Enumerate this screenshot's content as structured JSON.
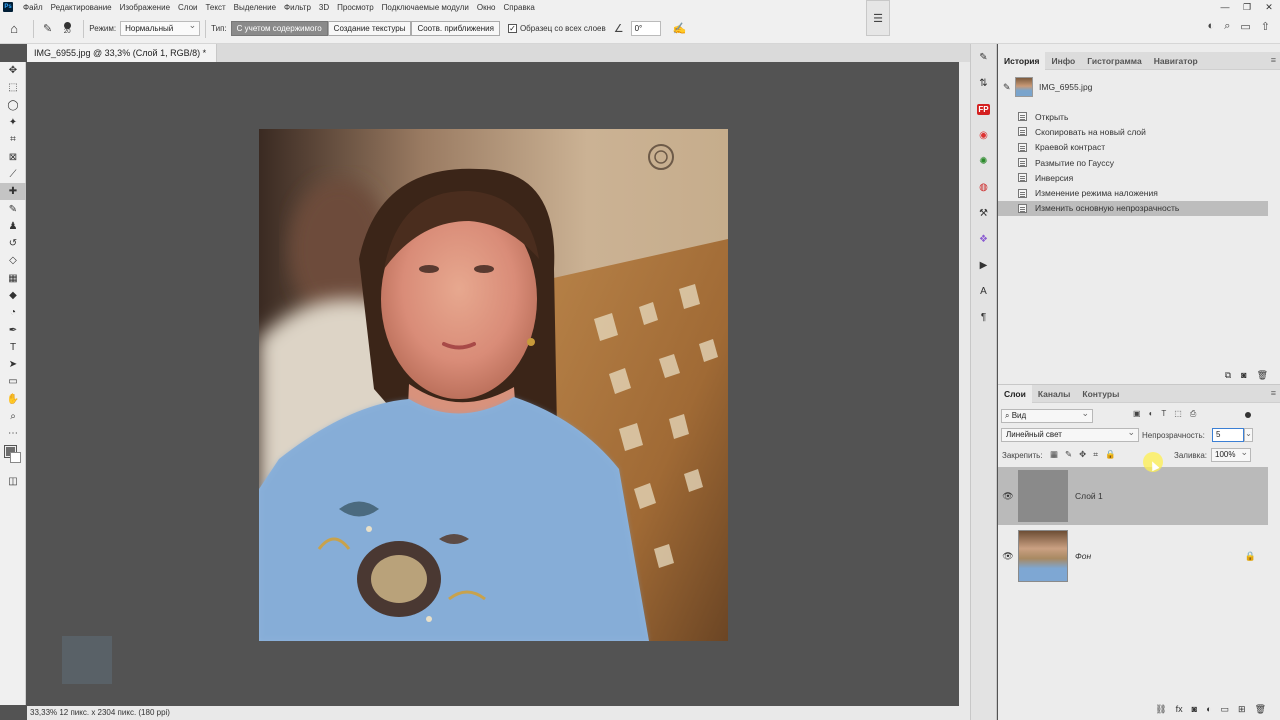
{
  "menubar": {
    "logo": "Ps",
    "items": [
      "Файл",
      "Редактирование",
      "Изображение",
      "Слои",
      "Текст",
      "Выделение",
      "Фильтр",
      "3D",
      "Просмотр",
      "Подключаемые модули",
      "Окно",
      "Справка"
    ],
    "window_controls": [
      "—",
      "❐",
      "✕"
    ]
  },
  "options": {
    "brush_size": "20",
    "mode_label": "Режим:",
    "mode_value": "Нормальный",
    "type_label": "Тип:",
    "type_options": [
      "С учетом содержимого",
      "Создание текстуры",
      "Соотв. приближения"
    ],
    "type_selected": "С учетом содержимого",
    "sample_all_label": "Образец со всех слоев",
    "sample_all_checked": true,
    "angle_value": "0°"
  },
  "document": {
    "tab_title": "IMG_6955.jpg @ 33,3% (Слой 1, RGB/8) *",
    "status": "33,33%   12 пикс. x 2304 пикс. (180 ppi)"
  },
  "tools": [
    "move",
    "marquee",
    "lasso",
    "magic-wand",
    "crop",
    "frame",
    "eyedropper",
    "healing-brush",
    "brush",
    "clone-stamp",
    "history-brush",
    "eraser",
    "gradient",
    "blur",
    "dodge",
    "pen",
    "type",
    "path-select",
    "rectangle",
    "hand",
    "zoom",
    "more"
  ],
  "history": {
    "tabs": [
      "История",
      "Инфо",
      "Гистограмма",
      "Навигатор"
    ],
    "active_tab": "История",
    "snapshot_name": "IMG_6955.jpg",
    "steps": [
      "Открыть",
      "Скопировать на новый слой",
      "Краевой контраст",
      "Размытие по Гауссу",
      "Инверсия",
      "Изменение режима наложения",
      "Изменить основную непрозрачность"
    ],
    "selected_step": "Изменить основную непрозрачность"
  },
  "layers": {
    "tabs": [
      "Слои",
      "Каналы",
      "Контуры"
    ],
    "active_tab": "Слои",
    "filter_value": "Вид",
    "blend_mode": "Линейный свет",
    "opacity_label": "Непрозрачность:",
    "opacity_value": "5",
    "lock_label": "Закрепить:",
    "fill_label": "Заливка:",
    "fill_value": "100%",
    "items": [
      {
        "name": "Слой 1",
        "visible": true,
        "selected": true,
        "locked": false
      },
      {
        "name": "Фон",
        "visible": true,
        "selected": false,
        "locked": true
      }
    ]
  },
  "colors": {
    "accent": "#3b7fd4",
    "selection": "#bababa",
    "canvas_bg": "#535353",
    "ui_bg": "#f0f0f0"
  }
}
